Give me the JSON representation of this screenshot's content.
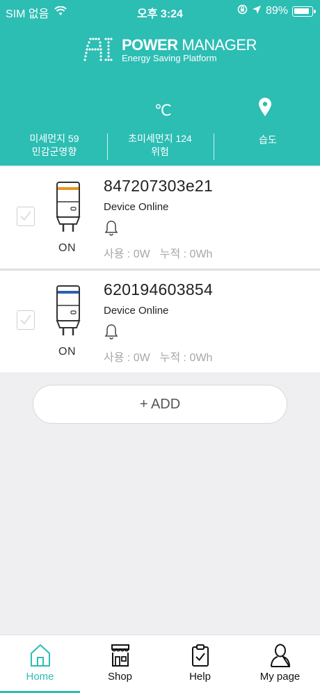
{
  "status_bar": {
    "carrier": "SIM 없음",
    "time": "오후 3:24",
    "battery": "89%"
  },
  "header": {
    "logo_ai": "AI",
    "logo_title_bold": "POWER",
    "logo_title_rest": "MANAGER",
    "logo_subtitle": "Energy Saving Platform",
    "temp_symbol": "℃",
    "metrics": {
      "fine_dust_line1": "미세먼지 59",
      "fine_dust_line2": "민감군영향",
      "ultrafine_dust_line1": "초미세먼지 124",
      "ultrafine_dust_line2": "위험",
      "humidity": "습도"
    }
  },
  "devices": [
    {
      "id": "847207303e21",
      "status": "Device Online",
      "state": "ON",
      "usage": "사용 : 0W",
      "cumulative": "누적 : 0Wh",
      "band_color": "#e8961e"
    },
    {
      "id": "620194603854",
      "status": "Device Online",
      "state": "ON",
      "usage": "사용 : 0W",
      "cumulative": "누적 : 0Wh",
      "band_color": "#2f5fb0"
    }
  ],
  "add_button": "+ ADD",
  "tabs": [
    {
      "label": "Home",
      "icon": "home-icon",
      "active": true
    },
    {
      "label": "Shop",
      "icon": "shop-icon"
    },
    {
      "label": "Help",
      "icon": "clipboard-icon"
    },
    {
      "label": "My page",
      "icon": "user-icon"
    }
  ],
  "colors": {
    "accent": "#2cbdb3"
  }
}
